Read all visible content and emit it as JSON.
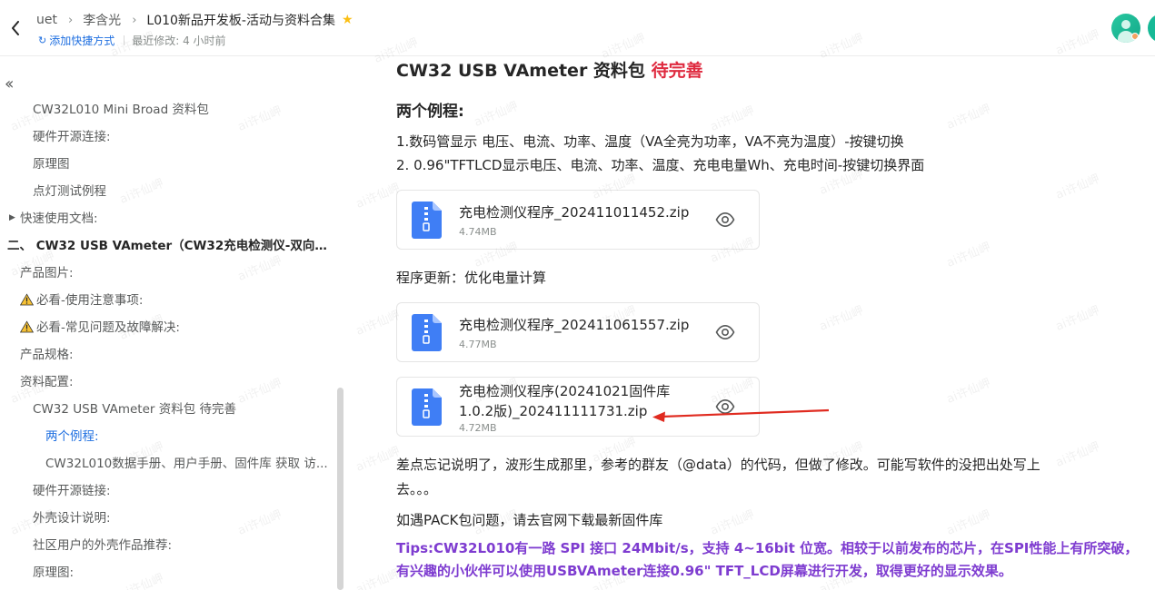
{
  "header": {
    "breadcrumb": [
      "uet",
      "李含光",
      "L010新品开发板-活动与资料合集"
    ],
    "add_shortcut": "添加快捷方式",
    "last_modified": "最近修改: 4 小时前"
  },
  "watermark": "ai许仙岬",
  "toc": {
    "items": [
      {
        "label": "CW32L010 Mini Broad 资料包",
        "level": "lv1"
      },
      {
        "label": "硬件开源连接:",
        "level": "lv1"
      },
      {
        "label": "原理图",
        "level": "lv1"
      },
      {
        "label": "点灯测试例程",
        "level": "lv1"
      },
      {
        "label": "快速使用文档:",
        "level": "lv0"
      },
      {
        "label": "二、 CW32 USB VAmeter（CW32充电检测仪-双向直...",
        "level": "top"
      },
      {
        "label": "产品图片:",
        "level": "lv0"
      },
      {
        "label": "必看-使用注意事项:",
        "level": "lv0"
      },
      {
        "label": "必看-常见问题及故障解决:",
        "level": "lv0"
      },
      {
        "label": "产品规格:",
        "level": "lv0"
      },
      {
        "label": "资料配置:",
        "level": "lv0"
      },
      {
        "label": "CW32 USB VAmeter 资料包 待完善",
        "level": "lv1"
      },
      {
        "label": "两个例程:",
        "level": "lv2"
      },
      {
        "label": "CW32L010数据手册、用户手册、固件库 获取 访...",
        "level": "lv2"
      },
      {
        "label": "硬件开源链接:",
        "level": "lv1"
      },
      {
        "label": "外壳设计说明:",
        "level": "lv1"
      },
      {
        "label": "社区用户的外壳作品推荐:",
        "level": "lv1"
      },
      {
        "label": "原理图:",
        "level": "lv1"
      }
    ]
  },
  "doc": {
    "title": "CW32 USB VAmeter 资料包",
    "title_status": "待完善",
    "section": "两个例程:",
    "line1": "1.数码管显示 电压、电流、功率、温度（VA全亮为功率，VA不亮为温度）-按键切换",
    "line2": "2. 0.96\"TFTLCD显示电压、电流、功率、温度、充电电量Wh、充电时间-按键切换界面",
    "update_note": "程序更新：优化电量计算",
    "files": [
      {
        "name": "充电检测仪程序_202411011452.zip",
        "size": "4.74MB"
      },
      {
        "name": "充电检测仪程序_202411061557.zip",
        "size": "4.77MB"
      },
      {
        "name": "充电检测仪程序(20241021固件库1.0.2版)_202411111731.zip",
        "size": "4.72MB"
      }
    ],
    "note_line1": "差点忘记说明了，波形生成那里，参考的群友（@data）的代码，但做了修改。可能写软件的没把出处写上",
    "note_line2": "去。。。",
    "pack_note": "如遇PACK包问题，请去官网下载最新固件库",
    "tips": "Tips:CW32L010有一路 SPI 接口 24Mbit/s，支持 4~16bit 位宽。相较于以前发布的芯片，在SPI性能上有所突破，有兴趣的小伙伴可以使用USBVAmeter连接0.96\" TFT_LCD屏幕进行开发，取得更好的显示效果。"
  },
  "colors": {
    "accent": "#1f6fe0",
    "pending": "#df2a3f",
    "tips": "#7e3cd0",
    "zip_icon": "#3f7ef5",
    "arrow": "#e02b20"
  }
}
